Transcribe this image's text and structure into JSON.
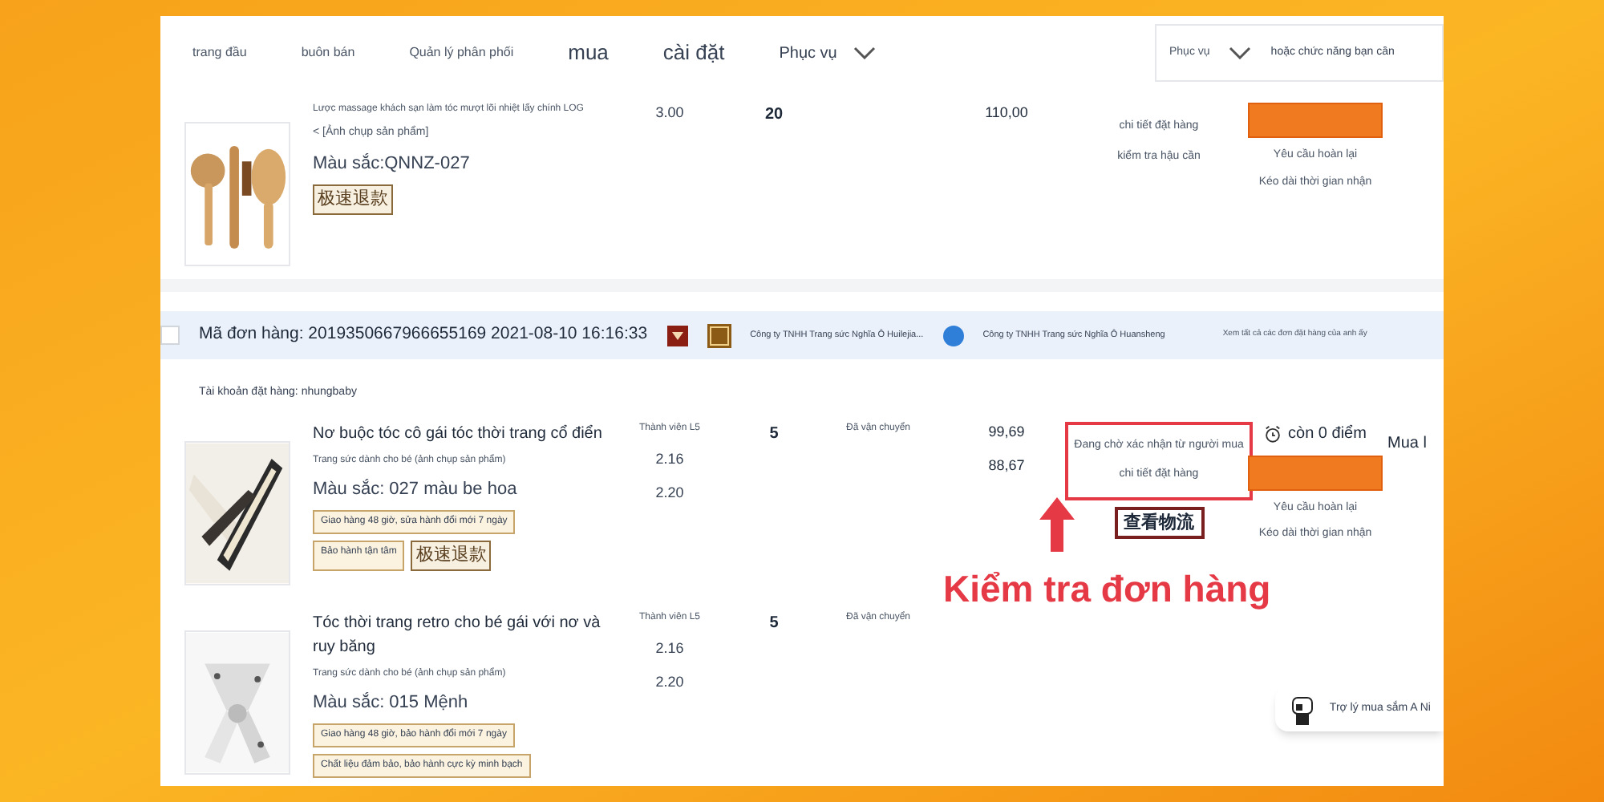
{
  "nav": {
    "items": [
      {
        "label": "trang đầu"
      },
      {
        "label": "buôn bán"
      },
      {
        "label": "Quản lý phân phối"
      },
      {
        "label": "mua"
      },
      {
        "label": "cài đặt"
      },
      {
        "label": "Phục vụ"
      }
    ],
    "search": {
      "scope": "Phục vụ",
      "placeholder": "hoặc chức năng bạn cần"
    }
  },
  "orders": [
    {
      "products": [
        {
          "lines": [
            {
              "kind": "tiny",
              "text": "Lược massage khách sạn làm tóc mượt lõi nhiệt lấy chính LOG"
            },
            {
              "kind": "small",
              "text": "< [Ảnh chụp sản phẩm]"
            },
            {
              "kind": "attr",
              "text": "Màu sắc:QNNZ-027"
            }
          ],
          "badges": [
            "极速退款"
          ],
          "price": [
            {
              "text": "3.00"
            }
          ],
          "qty": "20",
          "amount": [
            "110,00"
          ],
          "detail": {
            "lines": [
              "chi tiết đặt hàng",
              "kiểm tra hậu cần"
            ]
          },
          "actions": [
            "Yêu cầu hoàn lại",
            "Kéo dài thời gian nhận"
          ]
        }
      ]
    },
    {
      "header": {
        "checked": false,
        "order_no": "Mã đơn hàng: 2019350667966655169 2021-08-10 16:16:33",
        "shop_1": "Công ty TNHH Trang sức Nghĩa Ô Huilejia...",
        "shop_2": "Công ty TNHH Trang sức Nghĩa Ô Huansheng",
        "link": "Xem tất cả các đơn đặt hàng của anh ấy"
      },
      "account": "Tài khoản đặt hàng: nhungbaby",
      "products": [
        {
          "lines": [
            {
              "kind": "title",
              "text": "Nơ buộc tóc cô gái tóc thời trang cổ điển"
            },
            {
              "kind": "tiny",
              "text": "Trang sức dành cho bé (ảnh chụp sản phẩm)"
            },
            {
              "kind": "attr",
              "text": "Màu sắc: 027 màu be hoa"
            }
          ],
          "badges": [
            "Giao hàng 48 giờ, sửa hành đổi mới 7 ngày",
            "Bảo hành tận tâm",
            "极速退款"
          ],
          "price": [
            {
              "text": "Thành viên L5"
            },
            {
              "text": "2.16"
            },
            {
              "text": "2.20"
            }
          ],
          "qty": "5",
          "status": "Đã vận chuyển",
          "amount": [
            "99,69",
            "88,67"
          ],
          "detail": {
            "highlighted": true,
            "lines": [
              "Đang chờ xác nhận từ người mua",
              "chi tiết đặt hàng"
            ],
            "stamp": "查看物流"
          },
          "countdown": "còn 0 điểm",
          "actions": [
            "Yêu cầu hoàn lại",
            "Kéo dài thời gian nhận"
          ],
          "extra": "Mua l"
        },
        {
          "lines": [
            {
              "kind": "title",
              "text": "Tóc thời trang retro cho bé gái với nơ và ruy băng"
            },
            {
              "kind": "tiny",
              "text": "Trang sức dành cho bé (ảnh chụp sản phẩm)"
            },
            {
              "kind": "attr",
              "text": "Màu sắc: 015 Mệnh"
            }
          ],
          "badges": [
            "Giao hàng 48 giờ, bảo hành đổi mới 7 ngày",
            "Chất liệu đảm bảo, bảo hành cực kỳ minh bạch"
          ],
          "price": [
            {
              "text": "Thành viên L5"
            },
            {
              "text": "2.16"
            },
            {
              "text": "2.20"
            }
          ],
          "qty": "5",
          "status": "Đã vận chuyển"
        }
      ]
    }
  ],
  "annotation": "Kiểm tra đơn hàng",
  "assistant": "Trợ lý mua sắm A Ni"
}
